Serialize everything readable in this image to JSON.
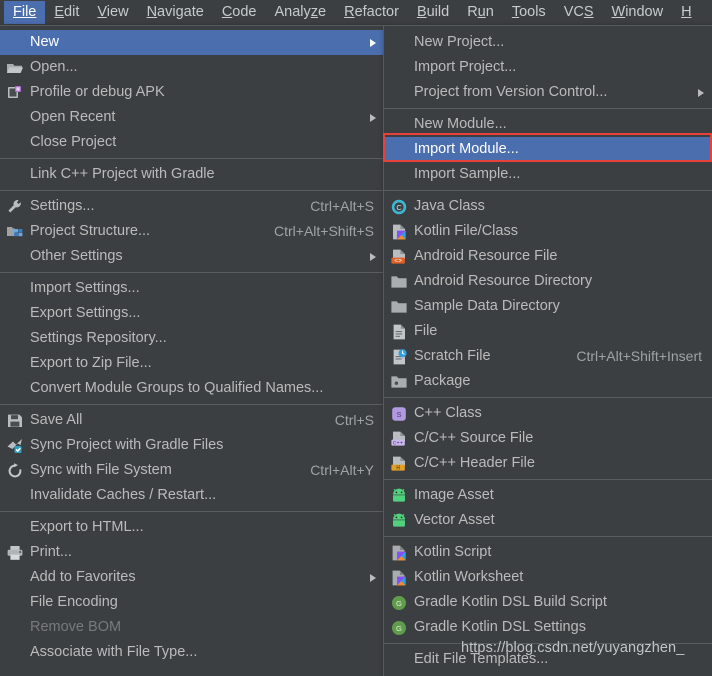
{
  "app": {
    "theme_bg": "#3c3f41",
    "accent": "#4b6eaf",
    "highlight_box_color": "#e8403a"
  },
  "menubar": {
    "items": [
      {
        "label": "File",
        "active": true
      },
      {
        "label": "Edit",
        "active": false
      },
      {
        "label": "View",
        "active": false
      },
      {
        "label": "Navigate",
        "active": false
      },
      {
        "label": "Code",
        "active": false
      },
      {
        "label": "Analyze",
        "active": false
      },
      {
        "label": "Refactor",
        "active": false
      },
      {
        "label": "Build",
        "active": false
      },
      {
        "label": "Run",
        "active": false
      },
      {
        "label": "Tools",
        "active": false
      },
      {
        "label": "VCS",
        "active": false
      },
      {
        "label": "Window",
        "active": false
      },
      {
        "label": "H",
        "active": false
      }
    ]
  },
  "file_menu": {
    "items": [
      {
        "label": "New",
        "icon": "none",
        "shortcut": "",
        "submenu": true,
        "selected": true,
        "disabled": false
      },
      {
        "label": "Open...",
        "icon": "folder-open-icon",
        "shortcut": "",
        "submenu": false,
        "selected": false,
        "disabled": false
      },
      {
        "label": "Profile or debug APK",
        "icon": "profile-apk-icon",
        "shortcut": "",
        "submenu": false,
        "selected": false,
        "disabled": false
      },
      {
        "label": "Open Recent",
        "icon": "none",
        "shortcut": "",
        "submenu": true,
        "selected": false,
        "disabled": false
      },
      {
        "label": "Close Project",
        "icon": "none",
        "shortcut": "",
        "submenu": false,
        "selected": false,
        "disabled": false
      },
      {
        "separator": true
      },
      {
        "label": "Link C++ Project with Gradle",
        "icon": "none",
        "shortcut": "",
        "submenu": false,
        "selected": false,
        "disabled": false
      },
      {
        "separator": true
      },
      {
        "label": "Settings...",
        "icon": "wrench-icon",
        "shortcut": "Ctrl+Alt+S",
        "submenu": false,
        "selected": false,
        "disabled": false
      },
      {
        "label": "Project Structure...",
        "icon": "project-structure-icon",
        "shortcut": "Ctrl+Alt+Shift+S",
        "submenu": false,
        "selected": false,
        "disabled": false
      },
      {
        "label": "Other Settings",
        "icon": "none",
        "shortcut": "",
        "submenu": true,
        "selected": false,
        "disabled": false
      },
      {
        "separator": true
      },
      {
        "label": "Import Settings...",
        "icon": "none",
        "shortcut": "",
        "submenu": false,
        "selected": false,
        "disabled": false
      },
      {
        "label": "Export Settings...",
        "icon": "none",
        "shortcut": "",
        "submenu": false,
        "selected": false,
        "disabled": false
      },
      {
        "label": "Settings Repository...",
        "icon": "none",
        "shortcut": "",
        "submenu": false,
        "selected": false,
        "disabled": false
      },
      {
        "label": "Export to Zip File...",
        "icon": "none",
        "shortcut": "",
        "submenu": false,
        "selected": false,
        "disabled": false
      },
      {
        "label": "Convert Module Groups to Qualified Names...",
        "icon": "none",
        "shortcut": "",
        "submenu": false,
        "selected": false,
        "disabled": false
      },
      {
        "separator": true
      },
      {
        "label": "Save All",
        "icon": "save-icon",
        "shortcut": "Ctrl+S",
        "submenu": false,
        "selected": false,
        "disabled": false
      },
      {
        "label": "Sync Project with Gradle Files",
        "icon": "sync-gradle-icon",
        "shortcut": "",
        "submenu": false,
        "selected": false,
        "disabled": false
      },
      {
        "label": "Sync with File System",
        "icon": "refresh-icon",
        "shortcut": "Ctrl+Alt+Y",
        "submenu": false,
        "selected": false,
        "disabled": false
      },
      {
        "label": "Invalidate Caches / Restart...",
        "icon": "none",
        "shortcut": "",
        "submenu": false,
        "selected": false,
        "disabled": false
      },
      {
        "separator": true
      },
      {
        "label": "Export to HTML...",
        "icon": "none",
        "shortcut": "",
        "submenu": false,
        "selected": false,
        "disabled": false
      },
      {
        "label": "Print...",
        "icon": "printer-icon",
        "shortcut": "",
        "submenu": false,
        "selected": false,
        "disabled": false
      },
      {
        "label": "Add to Favorites",
        "icon": "none",
        "shortcut": "",
        "submenu": true,
        "selected": false,
        "disabled": false
      },
      {
        "label": "File Encoding",
        "icon": "none",
        "shortcut": "",
        "submenu": false,
        "selected": false,
        "disabled": false
      },
      {
        "label": "Remove BOM",
        "icon": "none",
        "shortcut": "",
        "submenu": false,
        "selected": false,
        "disabled": true
      },
      {
        "label": "Associate with File Type...",
        "icon": "none",
        "shortcut": "",
        "submenu": false,
        "selected": false,
        "disabled": false
      }
    ]
  },
  "new_submenu": {
    "items": [
      {
        "label": "New Project...",
        "icon": "none",
        "shortcut": "",
        "submenu": false,
        "selected": false,
        "disabled": false
      },
      {
        "label": "Import Project...",
        "icon": "none",
        "shortcut": "",
        "submenu": false,
        "selected": false,
        "disabled": false
      },
      {
        "label": "Project from Version Control...",
        "icon": "none",
        "shortcut": "",
        "submenu": true,
        "selected": false,
        "disabled": false
      },
      {
        "separator": true
      },
      {
        "label": "New Module...",
        "icon": "none",
        "shortcut": "",
        "submenu": false,
        "selected": false,
        "disabled": false
      },
      {
        "label": "Import Module...",
        "icon": "none",
        "shortcut": "",
        "submenu": false,
        "selected": true,
        "disabled": false
      },
      {
        "label": "Import Sample...",
        "icon": "none",
        "shortcut": "",
        "submenu": false,
        "selected": false,
        "disabled": false
      },
      {
        "separator": true
      },
      {
        "label": "Java Class",
        "icon": "java-class-icon",
        "shortcut": "",
        "submenu": false,
        "selected": false,
        "disabled": false
      },
      {
        "label": "Kotlin File/Class",
        "icon": "kotlin-file-icon",
        "shortcut": "",
        "submenu": false,
        "selected": false,
        "disabled": false
      },
      {
        "label": "Android Resource File",
        "icon": "android-resource-file-icon",
        "shortcut": "",
        "submenu": false,
        "selected": false,
        "disabled": false
      },
      {
        "label": "Android Resource Directory",
        "icon": "folder-icon",
        "shortcut": "",
        "submenu": false,
        "selected": false,
        "disabled": false
      },
      {
        "label": "Sample Data Directory",
        "icon": "folder-icon",
        "shortcut": "",
        "submenu": false,
        "selected": false,
        "disabled": false
      },
      {
        "label": "File",
        "icon": "file-icon",
        "shortcut": "",
        "submenu": false,
        "selected": false,
        "disabled": false
      },
      {
        "label": "Scratch File",
        "icon": "scratch-file-icon",
        "shortcut": "Ctrl+Alt+Shift+Insert",
        "submenu": false,
        "selected": false,
        "disabled": false
      },
      {
        "label": "Package",
        "icon": "package-icon",
        "shortcut": "",
        "submenu": false,
        "selected": false,
        "disabled": false
      },
      {
        "separator": true
      },
      {
        "label": "C++ Class",
        "icon": "cpp-class-icon",
        "shortcut": "",
        "submenu": false,
        "selected": false,
        "disabled": false
      },
      {
        "label": "C/C++ Source File",
        "icon": "cpp-source-icon",
        "shortcut": "",
        "submenu": false,
        "selected": false,
        "disabled": false
      },
      {
        "label": "C/C++ Header File",
        "icon": "cpp-header-icon",
        "shortcut": "",
        "submenu": false,
        "selected": false,
        "disabled": false
      },
      {
        "separator": true
      },
      {
        "label": "Image Asset",
        "icon": "android-icon",
        "shortcut": "",
        "submenu": false,
        "selected": false,
        "disabled": false
      },
      {
        "label": "Vector Asset",
        "icon": "android-icon",
        "shortcut": "",
        "submenu": false,
        "selected": false,
        "disabled": false
      },
      {
        "separator": true
      },
      {
        "label": "Kotlin Script",
        "icon": "kotlin-script-icon",
        "shortcut": "",
        "submenu": false,
        "selected": false,
        "disabled": false
      },
      {
        "label": "Kotlin Worksheet",
        "icon": "kotlin-script-icon",
        "shortcut": "",
        "submenu": false,
        "selected": false,
        "disabled": false
      },
      {
        "label": "Gradle Kotlin DSL Build Script",
        "icon": "gradle-icon",
        "shortcut": "",
        "submenu": false,
        "selected": false,
        "disabled": false
      },
      {
        "label": "Gradle Kotlin DSL Settings",
        "icon": "gradle-icon",
        "shortcut": "",
        "submenu": false,
        "selected": false,
        "disabled": false
      },
      {
        "separator": true
      },
      {
        "label": "Edit File Templates...",
        "icon": "none",
        "shortcut": "",
        "submenu": false,
        "selected": false,
        "disabled": false
      }
    ]
  },
  "watermark": {
    "text": "https://blog.csdn.net/yuyangzhen_"
  }
}
